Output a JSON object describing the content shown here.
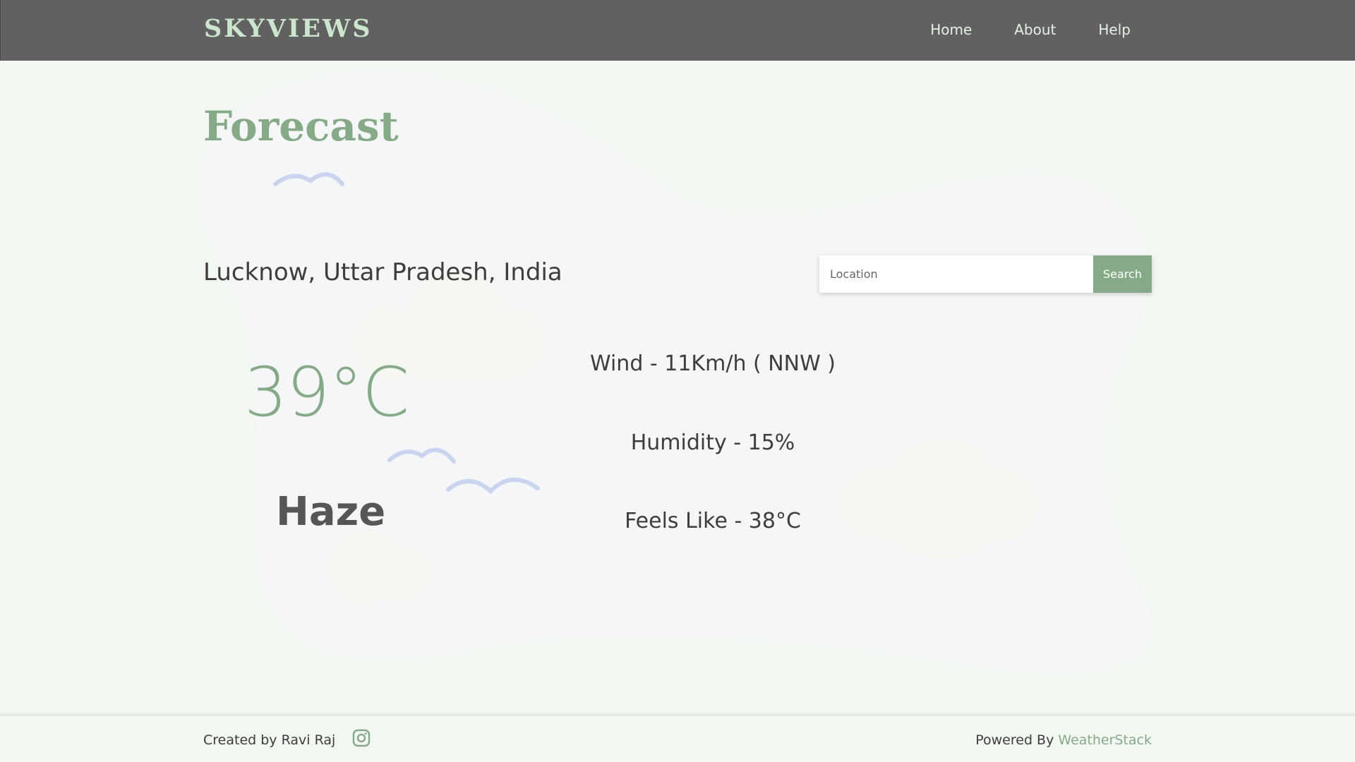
{
  "header": {
    "brand": "SKYVIEWS",
    "nav": [
      {
        "label": "Home"
      },
      {
        "label": "About"
      },
      {
        "label": "Help"
      }
    ]
  },
  "main": {
    "title": "Forecast",
    "location_name": "Lucknow, Uttar Pradesh, India",
    "search": {
      "placeholder": "Location",
      "value": "",
      "button_label": "Search"
    },
    "temperature": "39°C",
    "condition": "Haze",
    "wind": "Wind - 11Km/h ( NNW )",
    "humidity": "Humidity - 15%",
    "feels_like": "Feels Like - 38°C"
  },
  "footer": {
    "created_by": "Created by Ravi Raj",
    "instagram_icon": "instagram-icon",
    "powered_prefix": "Powered By",
    "powered_link": "WeatherStack"
  },
  "colors": {
    "header_bg": "#616161",
    "brand": "#cbe6cc",
    "accent": "#86aa88",
    "page_bg": "#f3f7f1",
    "blob": "#f4f6f8",
    "bird": "#c9d4ee",
    "cloud": "#f5f8f1"
  }
}
